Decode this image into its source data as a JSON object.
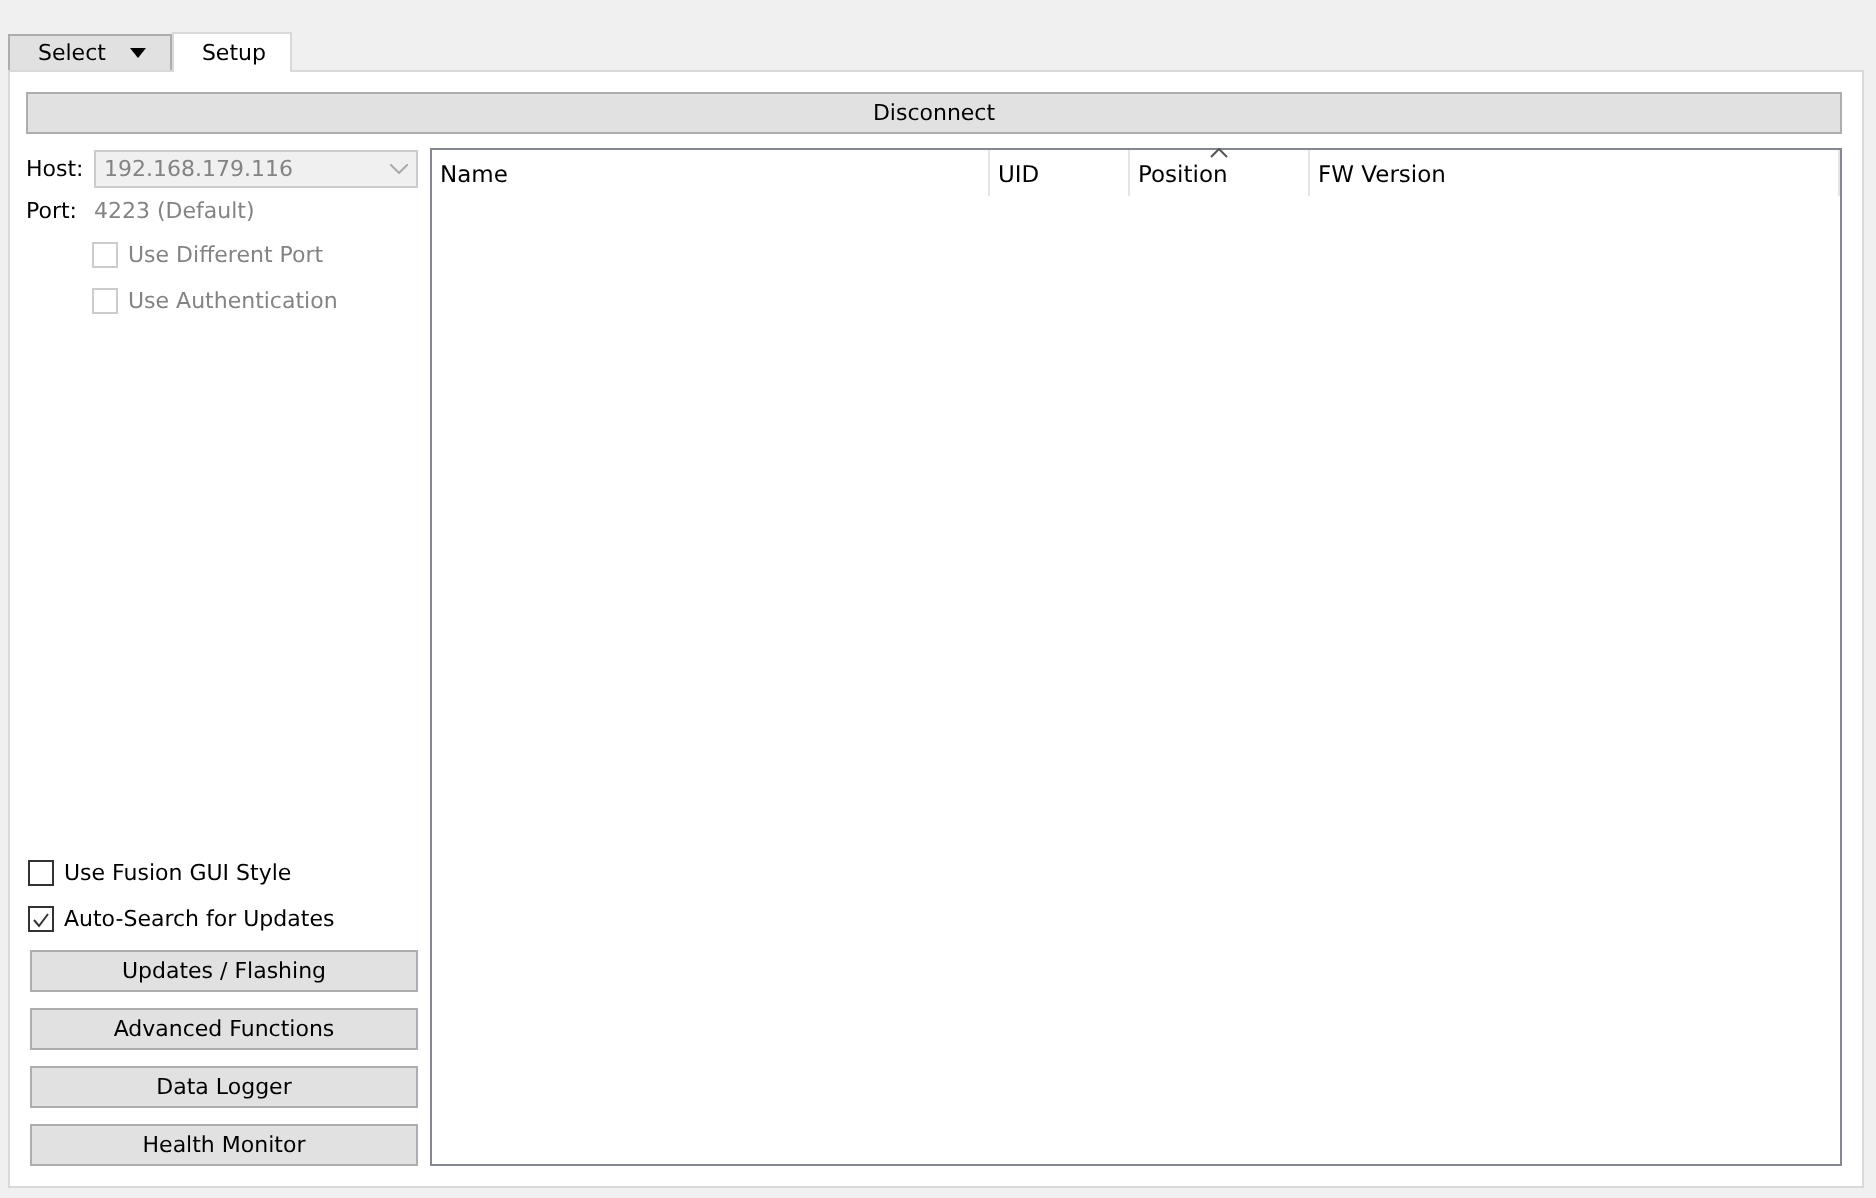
{
  "tabs": [
    {
      "label": "Select",
      "kind": "dropdown",
      "selected": false
    },
    {
      "label": "Setup",
      "kind": "plain",
      "selected": true
    }
  ],
  "disconnect_button": "Disconnect",
  "connection": {
    "host_label": "Host:",
    "host_value": "192.168.179.116",
    "host_disabled": true,
    "port_label": "Port:",
    "port_value": "4223 (Default)",
    "options": [
      {
        "label": "Use Different Port",
        "checked": false,
        "disabled": true
      },
      {
        "label": "Use Authentication",
        "checked": false,
        "disabled": true
      }
    ]
  },
  "settings": [
    {
      "label": "Use Fusion GUI Style",
      "checked": false,
      "disabled": false
    },
    {
      "label": "Auto-Search for Updates",
      "checked": true,
      "disabled": false
    }
  ],
  "buttons": [
    "Updates / Flashing",
    "Advanced Functions",
    "Data Logger",
    "Health Monitor"
  ],
  "table": {
    "columns": [
      {
        "label": "Name",
        "sorted": false
      },
      {
        "label": "UID",
        "sorted": false
      },
      {
        "label": "Position",
        "sorted": true
      },
      {
        "label": "FW Version",
        "sorted": false
      }
    ]
  }
}
